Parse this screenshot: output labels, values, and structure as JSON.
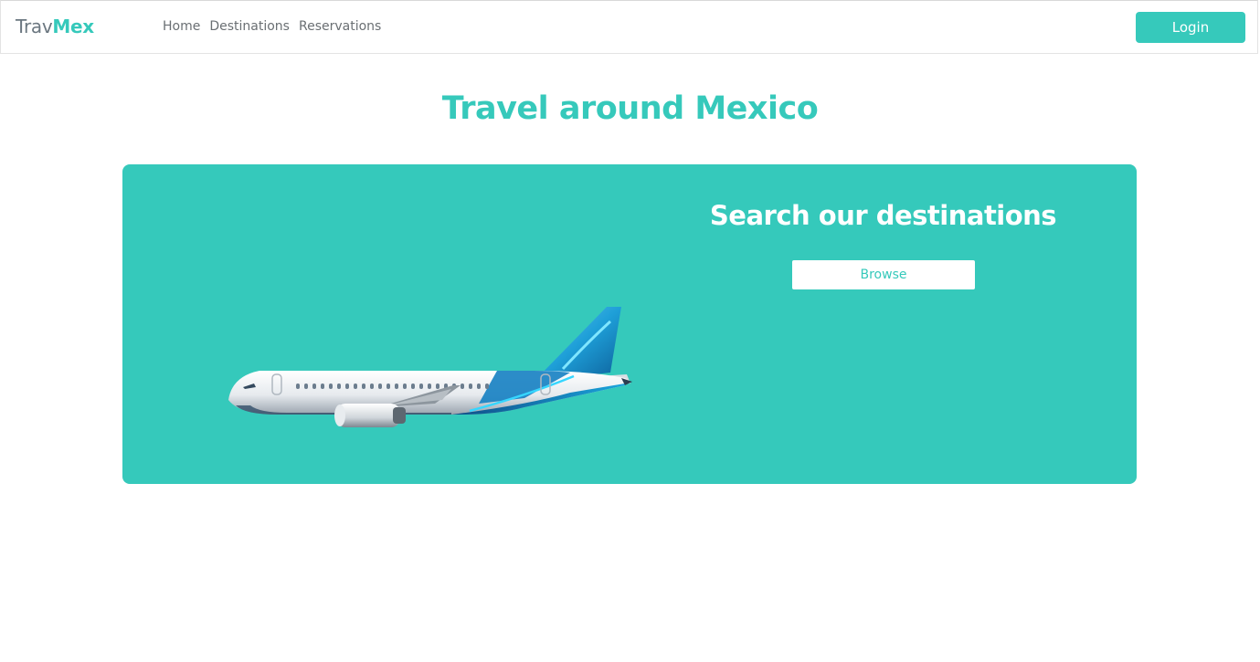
{
  "navbar": {
    "brand_part1": "Trav",
    "brand_part2": "Mex",
    "links": [
      "Home",
      "Destinations",
      "Reservations"
    ],
    "login_label": "Login"
  },
  "hero": {
    "title": "Travel around Mexico"
  },
  "search_card": {
    "title": "Search our destinations",
    "browse_label": "Browse",
    "image": "airplane-illustration"
  },
  "colors": {
    "accent": "#36c9bb",
    "card_bg": "#35c9bb",
    "nav_text": "#6a6f73",
    "white": "#ffffff"
  }
}
